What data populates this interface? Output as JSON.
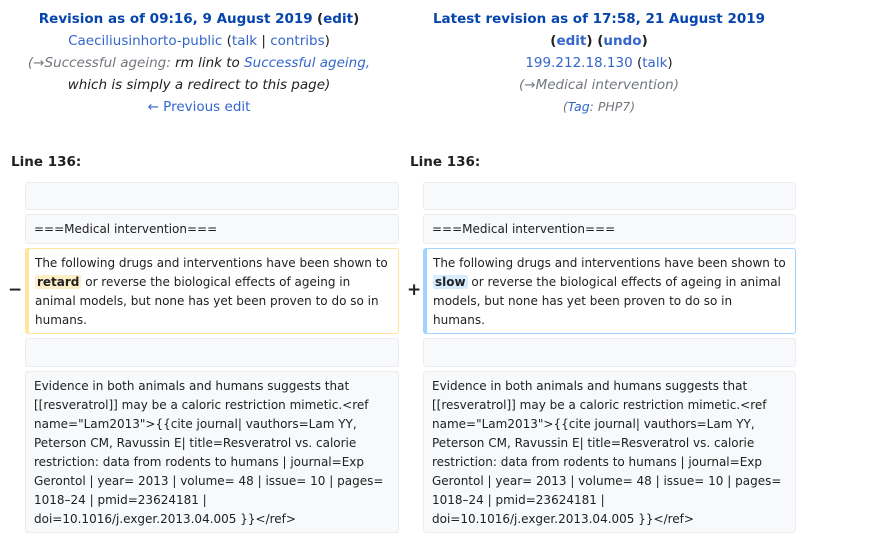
{
  "left": {
    "revision_prefix": "Revision as of 09:16, 9 August 2019",
    "edit_label": "edit",
    "user": "Caeciliusinhorto-public",
    "talk_label": "talk",
    "contribs_label": "contribs",
    "comment_arrow": "(→",
    "comment_section": "Successful ageing:",
    "comment_text_1": " rm link to ",
    "comment_link": "Successful ageing,",
    "comment_text_2": "which is simply a redirect to this page)",
    "prev_edit": "← Previous edit"
  },
  "right": {
    "revision_prefix": "Latest revision as of 17:58, 21 August 2019",
    "edit_label": "edit",
    "undo_label": "undo",
    "user": "199.212.18.130",
    "talk_label": "talk",
    "comment": "(→Medical intervention)",
    "tag_prefix": "(",
    "tag_label": "Tag",
    "tag_value": ": PHP7",
    "tag_suffix": ")"
  },
  "diff": {
    "line_label": "Line 136:",
    "section_heading": "===Medical intervention===",
    "del_marker": "−",
    "add_marker": "+",
    "para_before": "The following drugs and interventions have been shown to ",
    "word_old": "retard",
    "word_new": "slow",
    "para_after": " or reverse the biological effects of ageing in animal models, but none has yet been proven to do so in humans.",
    "evidence": "Evidence in both animals and humans suggests that [[resveratrol]] may be a caloric restriction mimetic.<ref name=\"Lam2013\">{{cite journal| vauthors=Lam YY, Peterson CM, Ravussin E| title=Resveratrol vs. calorie restriction: data from rodents to humans | journal=Exp Gerontol | year= 2013 | volume= 48 | issue= 10 | pages= 1018–24 | pmid=23624181 | doi=10.1016/j.exger.2013.04.005 }}</ref>"
  }
}
